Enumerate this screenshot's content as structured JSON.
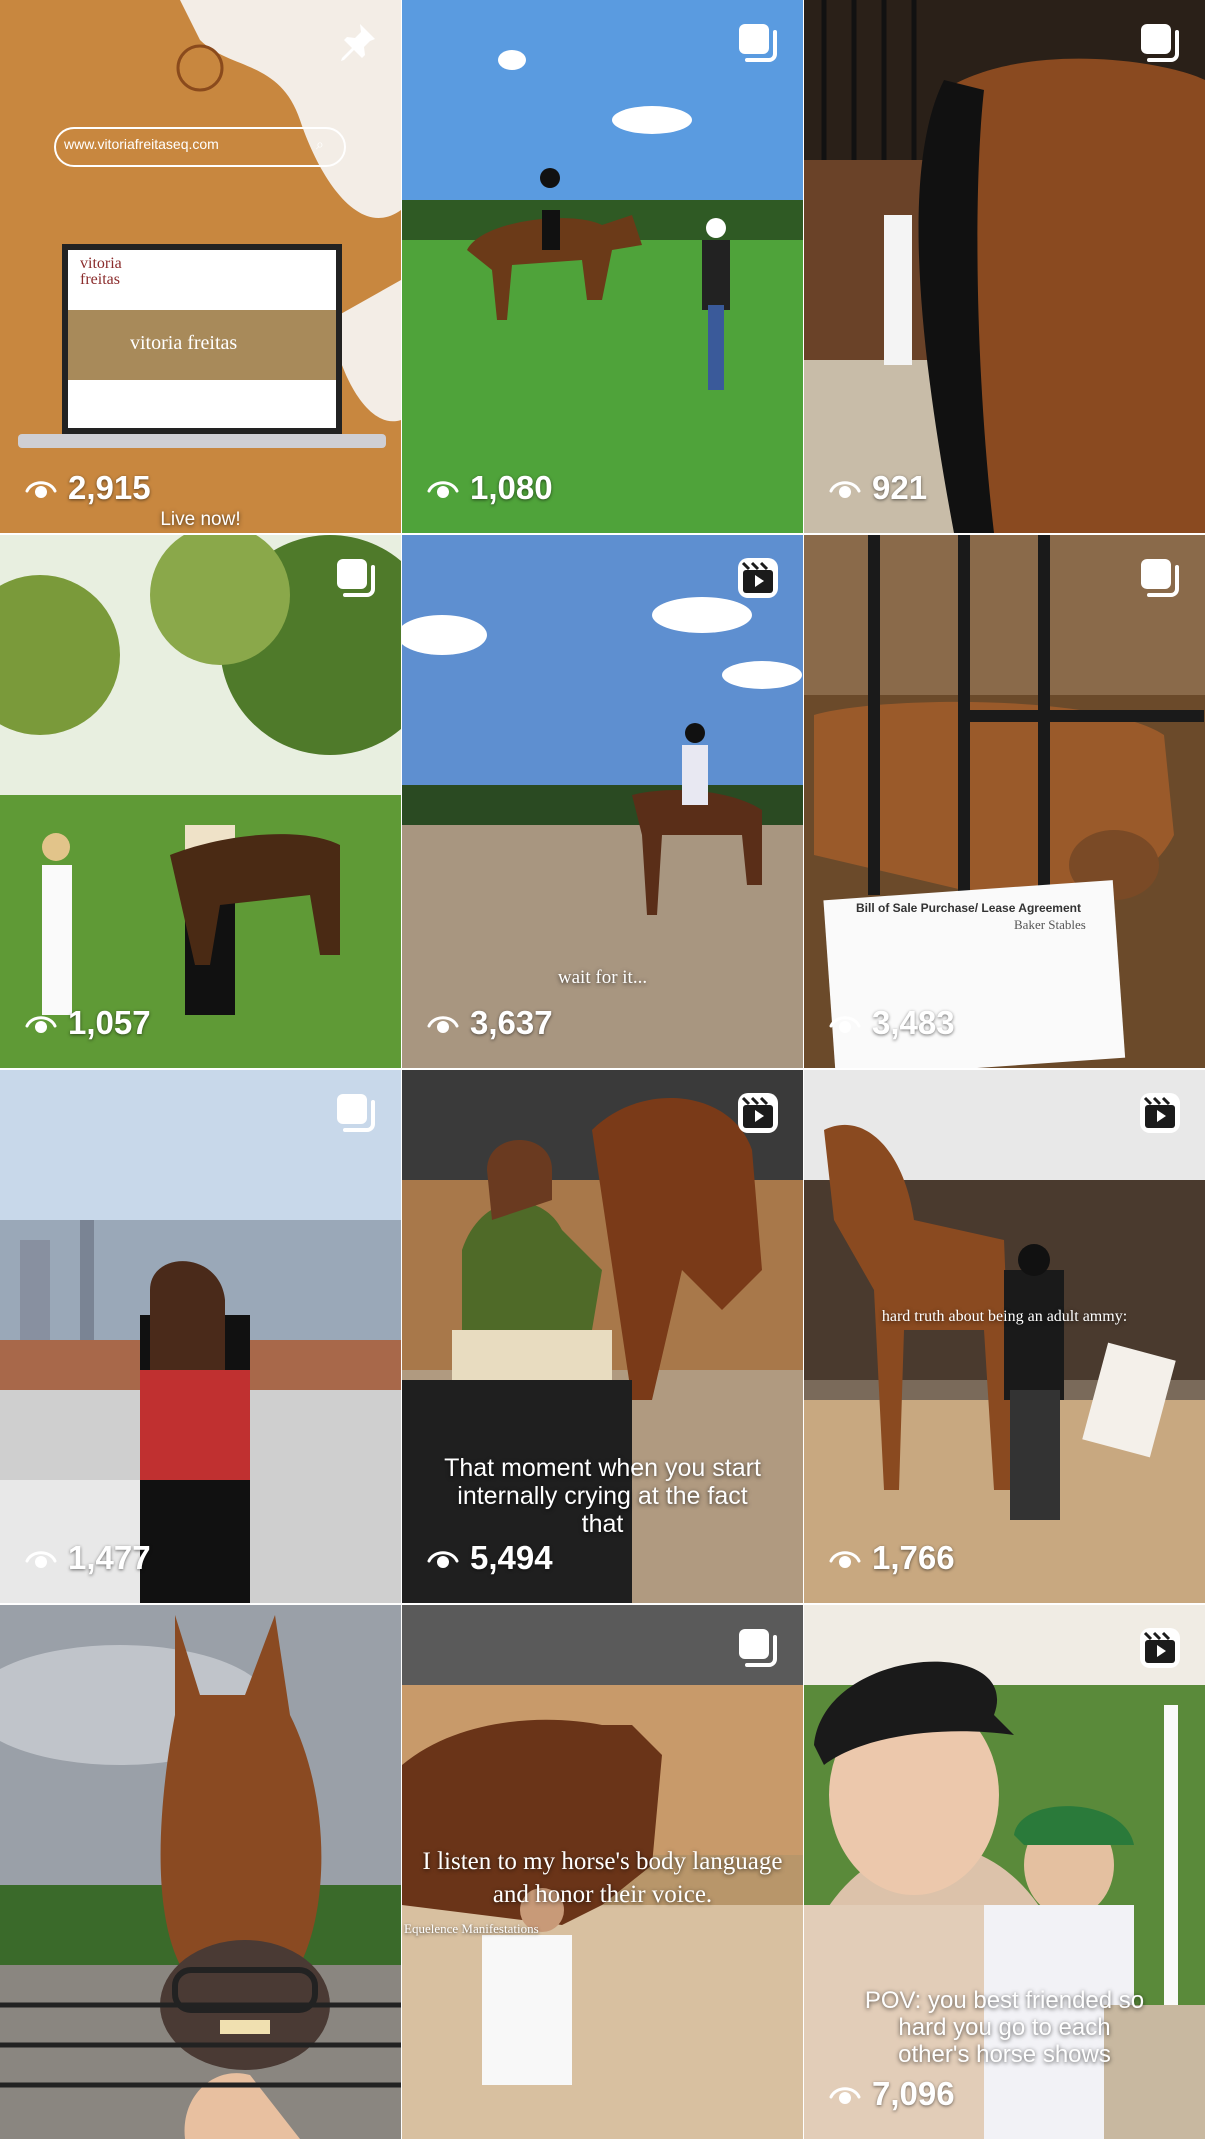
{
  "posts": [
    {
      "views": "2,915",
      "badge": "pin-icon",
      "url": "www.vitoriafreitaseq.com",
      "logo": "vitoria freitas",
      "site_hero": "vitoria freitas",
      "caption": "Live now!"
    },
    {
      "views": "1,080",
      "badge": "multi-photo-icon"
    },
    {
      "views": "921",
      "badge": "multi-photo-icon"
    },
    {
      "views": "1,057",
      "badge": "multi-photo-icon"
    },
    {
      "views": "3,637",
      "badge": "reel-icon",
      "caption": "wait for it..."
    },
    {
      "views": "3,483",
      "badge": "multi-photo-icon",
      "doc_title": "Bill of Sale Purchase/ Lease Agreement",
      "doc_stamp": "Baker Stables"
    },
    {
      "views": "1,477",
      "badge": "multi-photo-icon"
    },
    {
      "views": "5,494",
      "badge": "reel-icon",
      "caption": "That moment when you start internally crying at the fact that"
    },
    {
      "views": "1,766",
      "badge": "reel-icon",
      "caption": "hard truth about being an adult ammy:"
    },
    {
      "views": "",
      "badge": "none"
    },
    {
      "views": "",
      "badge": "multi-photo-icon",
      "caption": "I listen to my horse's body language and honor their voice.",
      "sub_caption": "Equelence Manifestations"
    },
    {
      "views": "7,096",
      "badge": "reel-icon",
      "caption": "POV: you best friended so hard you go to each other's horse shows"
    }
  ],
  "colors": {
    "overlay_text": "#ffffff",
    "grid_gap": "#ffffff"
  }
}
